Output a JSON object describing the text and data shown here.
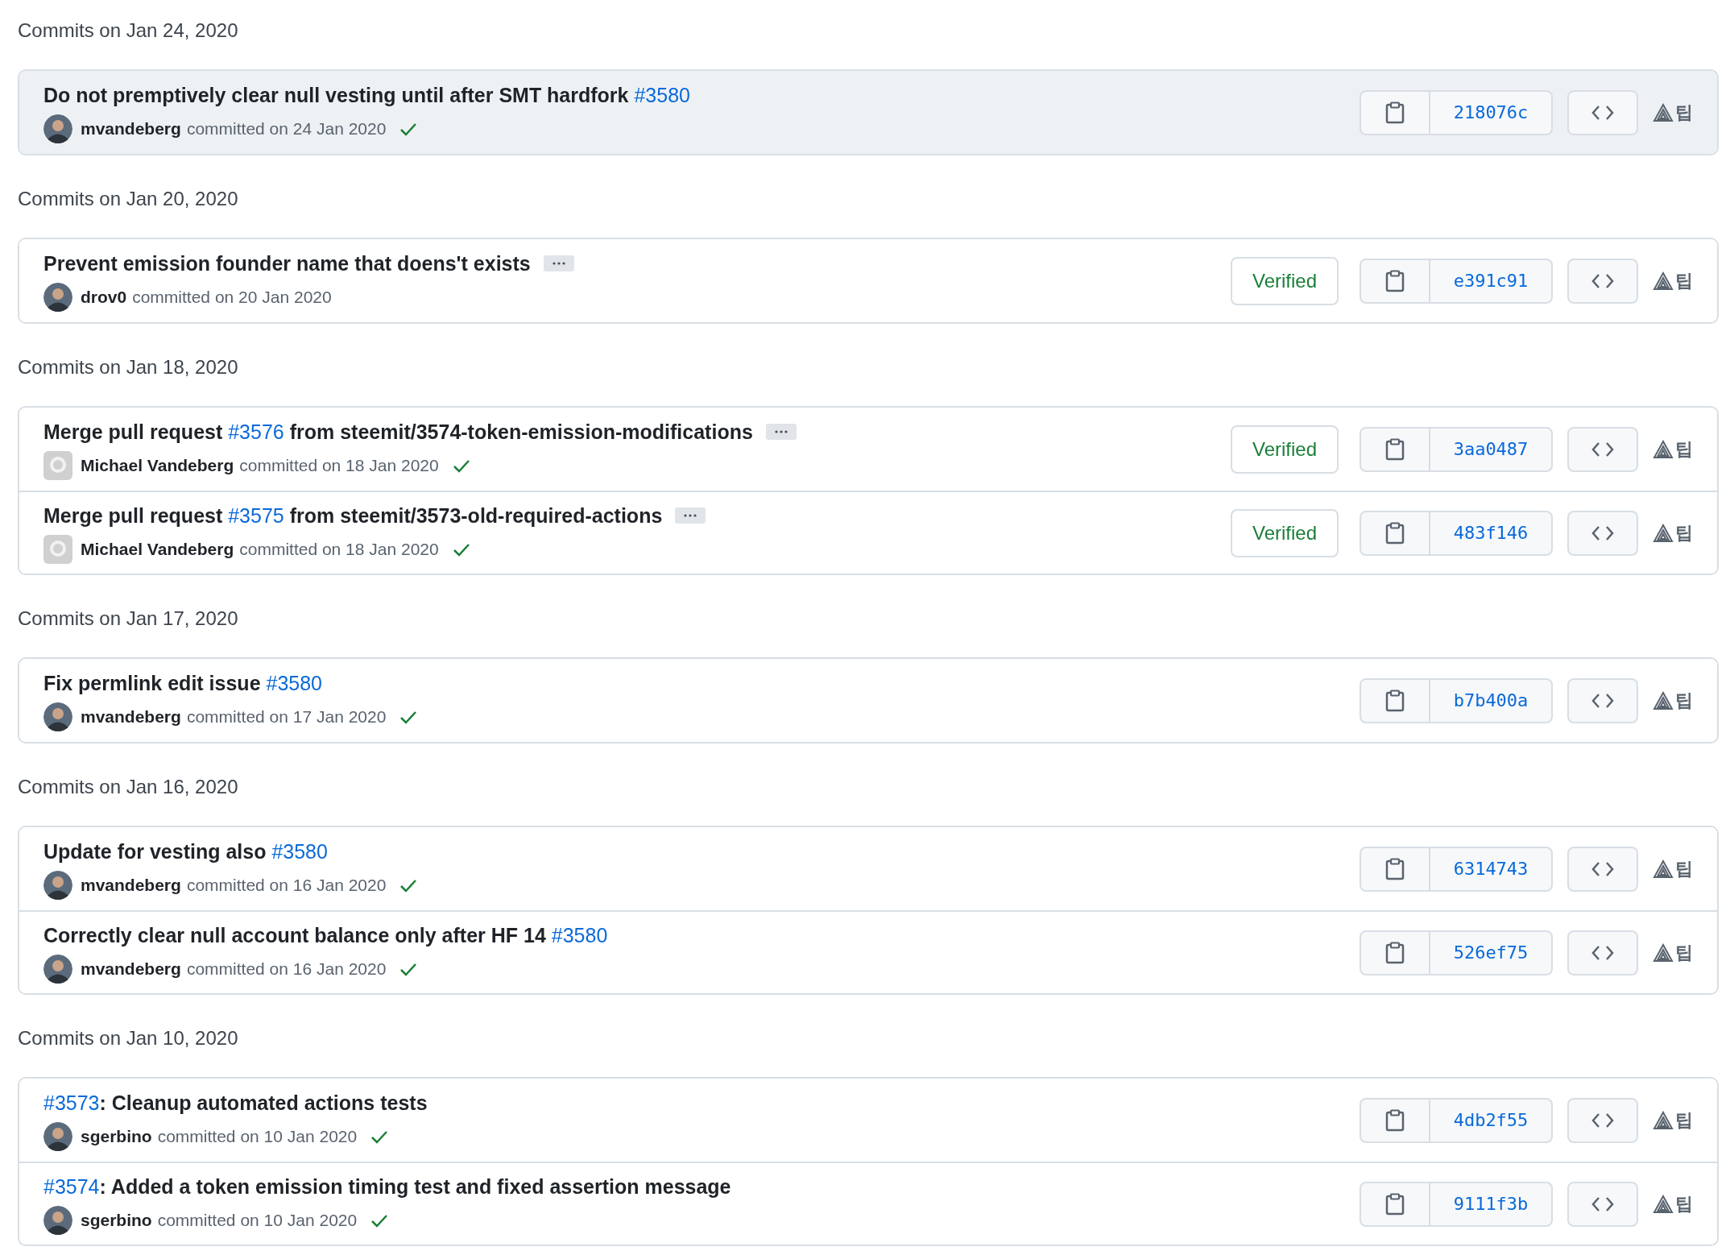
{
  "groups": [
    {
      "heading": "Commits on Jan 24, 2020",
      "commits": [
        {
          "title": [
            {
              "text": "Do not premptively clear null vesting until after SMT hardfork ",
              "link": false
            },
            {
              "text": "#3580",
              "link": true
            }
          ],
          "more": false,
          "default_avatar": false,
          "author": "mvandeberg",
          "meta": "committed on 24 Jan 2020",
          "check": true,
          "highlighted": true,
          "sha": "218076c",
          "tip": "팁"
        }
      ]
    },
    {
      "heading": "Commits on Jan 20, 2020",
      "commits": [
        {
          "title": [
            {
              "text": "Prevent emission founder name that doens't exists",
              "link": false
            }
          ],
          "more": true,
          "default_avatar": false,
          "author": "drov0",
          "meta": "committed on 20 Jan 2020",
          "check": false,
          "verified": "Verified",
          "highlighted": false,
          "sha": "e391c91",
          "tip": "팁"
        }
      ]
    },
    {
      "heading": "Commits on Jan 18, 2020",
      "commits": [
        {
          "title": [
            {
              "text": "Merge pull request ",
              "link": false
            },
            {
              "text": "#3576",
              "link": true
            },
            {
              "text": " from steemit/3574-token-emission-modifications",
              "link": false
            }
          ],
          "more": true,
          "default_avatar": true,
          "author": "Michael Vandeberg",
          "meta": "committed on 18 Jan 2020",
          "check": true,
          "verified": "Verified",
          "highlighted": false,
          "sha": "3aa0487",
          "tip": "팁"
        },
        {
          "title": [
            {
              "text": "Merge pull request ",
              "link": false
            },
            {
              "text": "#3575",
              "link": true
            },
            {
              "text": " from steemit/3573-old-required-actions",
              "link": false
            }
          ],
          "more": true,
          "default_avatar": true,
          "author": "Michael Vandeberg",
          "meta": "committed on 18 Jan 2020",
          "check": true,
          "verified": "Verified",
          "highlighted": false,
          "sha": "483f146",
          "tip": "팁"
        }
      ]
    },
    {
      "heading": "Commits on Jan 17, 2020",
      "commits": [
        {
          "title": [
            {
              "text": "Fix permlink edit issue ",
              "link": false
            },
            {
              "text": "#3580",
              "link": true
            }
          ],
          "more": false,
          "default_avatar": false,
          "author": "mvandeberg",
          "meta": "committed on 17 Jan 2020",
          "check": true,
          "highlighted": false,
          "sha": "b7b400a",
          "tip": "팁"
        }
      ]
    },
    {
      "heading": "Commits on Jan 16, 2020",
      "commits": [
        {
          "title": [
            {
              "text": "Update for vesting also ",
              "link": false
            },
            {
              "text": "#3580",
              "link": true
            }
          ],
          "more": false,
          "default_avatar": false,
          "author": "mvandeberg",
          "meta": "committed on 16 Jan 2020",
          "check": true,
          "highlighted": false,
          "sha": "6314743",
          "tip": "팁"
        },
        {
          "title": [
            {
              "text": "Correctly clear null account balance only after HF 14 ",
              "link": false
            },
            {
              "text": "#3580",
              "link": true
            }
          ],
          "more": false,
          "default_avatar": false,
          "author": "mvandeberg",
          "meta": "committed on 16 Jan 2020",
          "check": true,
          "highlighted": false,
          "sha": "526ef75",
          "tip": "팁"
        }
      ]
    },
    {
      "heading": "Commits on Jan 10, 2020",
      "commits": [
        {
          "title": [
            {
              "text": "#3573",
              "link": true
            },
            {
              "text": ": Cleanup automated actions tests",
              "link": false
            }
          ],
          "more": false,
          "default_avatar": false,
          "author": "sgerbino",
          "meta": "committed on 10 Jan 2020",
          "check": true,
          "highlighted": false,
          "sha": "4db2f55",
          "tip": "팁"
        },
        {
          "title": [
            {
              "text": "#3574",
              "link": true
            },
            {
              "text": ": Added a token emission timing test and fixed assertion message",
              "link": false
            }
          ],
          "more": false,
          "default_avatar": false,
          "author": "sgerbino",
          "meta": "committed on 10 Jan 2020",
          "check": true,
          "highlighted": false,
          "sha": "9111f3b",
          "tip": "팁"
        }
      ]
    }
  ]
}
